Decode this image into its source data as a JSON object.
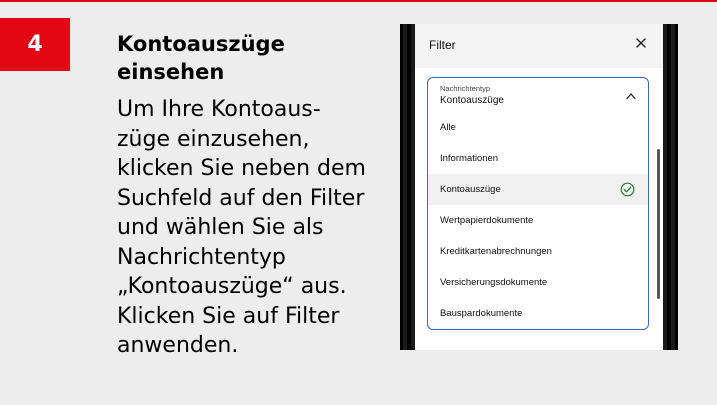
{
  "step": {
    "number": "4",
    "heading": "Kontoauszüge einsehen",
    "body": "Um Ihre Kontoaus- züge einzusehen, klicken Sie neben dem Suchfeld auf den Filter und wählen Sie als Nachrichtentyp „Kontoauszüge“ aus. Klicken Sie auf Filter anwenden."
  },
  "phone": {
    "filter_title": "Filter",
    "close_icon": "close-icon",
    "select": {
      "label": "Nachrichtentyp",
      "value": "Kontoauszüge",
      "chevron_icon": "chevron-up-icon"
    },
    "options": [
      {
        "label": "Alle",
        "selected": false
      },
      {
        "label": "Informationen",
        "selected": false
      },
      {
        "label": "Kontoauszüge",
        "selected": true
      },
      {
        "label": "Wertpapierdokumente",
        "selected": false
      },
      {
        "label": "Kreditkartenabrechnungen",
        "selected": false
      },
      {
        "label": "Versicherungsdokumente",
        "selected": false
      },
      {
        "label": "Bauspardokumente",
        "selected": false
      }
    ],
    "check_icon": "check-circle-icon"
  },
  "colors": {
    "accent_red": "#e30613",
    "card_background": "#ededed",
    "dropdown_border": "#3a68b8",
    "check_green": "#2e7d32"
  }
}
